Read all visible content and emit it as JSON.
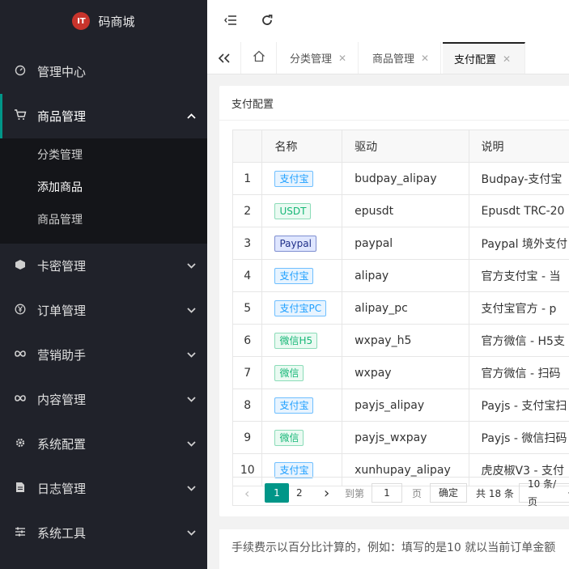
{
  "app": {
    "logo_badge": "IT",
    "title": "码商城"
  },
  "sidebar": {
    "items": [
      {
        "label": "管理中心",
        "icon": "dashboard-icon"
      },
      {
        "label": "商品管理",
        "icon": "cart-icon",
        "expanded": true
      },
      {
        "label": "卡密管理",
        "icon": "cube-icon"
      },
      {
        "label": "订单管理",
        "icon": "yen-icon"
      },
      {
        "label": "营销助手",
        "icon": "infinity-icon"
      },
      {
        "label": "内容管理",
        "icon": "infinity-icon"
      },
      {
        "label": "系统配置",
        "icon": "gear-icon"
      },
      {
        "label": "日志管理",
        "icon": "document-icon"
      },
      {
        "label": "系统工具",
        "icon": "sliders-icon"
      }
    ],
    "submenu": [
      "分类管理",
      "添加商品",
      "商品管理"
    ]
  },
  "tabs": [
    {
      "label": "分类管理"
    },
    {
      "label": "商品管理"
    },
    {
      "label": "支付配置",
      "active": true
    }
  ],
  "card": {
    "title": "支付配置"
  },
  "table": {
    "headers": [
      "名称",
      "驱动",
      "说明"
    ],
    "rows": [
      {
        "idx": "1",
        "name": "支付宝",
        "tag": "blue",
        "driver": "budpay_alipay",
        "desc": "Budpay-支付宝"
      },
      {
        "idx": "2",
        "name": "USDT",
        "tag": "green",
        "driver": "epusdt",
        "desc": "Epusdt TRC-20"
      },
      {
        "idx": "3",
        "name": "Paypal",
        "tag": "navy",
        "driver": "paypal",
        "desc": "Paypal 境外支付"
      },
      {
        "idx": "4",
        "name": "支付宝",
        "tag": "blue",
        "driver": "alipay",
        "desc": "官方支付宝 - 当"
      },
      {
        "idx": "5",
        "name": "支付宝PC",
        "tag": "blue",
        "driver": "alipay_pc",
        "desc": "支付宝官方 - p"
      },
      {
        "idx": "6",
        "name": "微信H5",
        "tag": "green",
        "driver": "wxpay_h5",
        "desc": "官方微信 - H5支"
      },
      {
        "idx": "7",
        "name": "微信",
        "tag": "green",
        "driver": "wxpay",
        "desc": "官方微信 - 扫码"
      },
      {
        "idx": "8",
        "name": "支付宝",
        "tag": "blue",
        "driver": "payjs_alipay",
        "desc": "Payjs - 支付宝扫"
      },
      {
        "idx": "9",
        "name": "微信",
        "tag": "green",
        "driver": "payjs_wxpay",
        "desc": "Payjs - 微信扫码"
      },
      {
        "idx": "10",
        "name": "支付宝",
        "tag": "blue",
        "driver": "xunhupay_alipay",
        "desc": "虎皮椒V3 - 支付"
      }
    ]
  },
  "pager": {
    "prev": "‹",
    "page1": "1",
    "page2": "2",
    "next": "›",
    "goto_label": "到第",
    "goto_value": "1",
    "page_suffix": "页",
    "confirm": "确定",
    "total": "共 18 条",
    "per_page": "10 条/页"
  },
  "note": "手续费示以百分比计算的，例如：填写的是10 就以当前订单金额"
}
